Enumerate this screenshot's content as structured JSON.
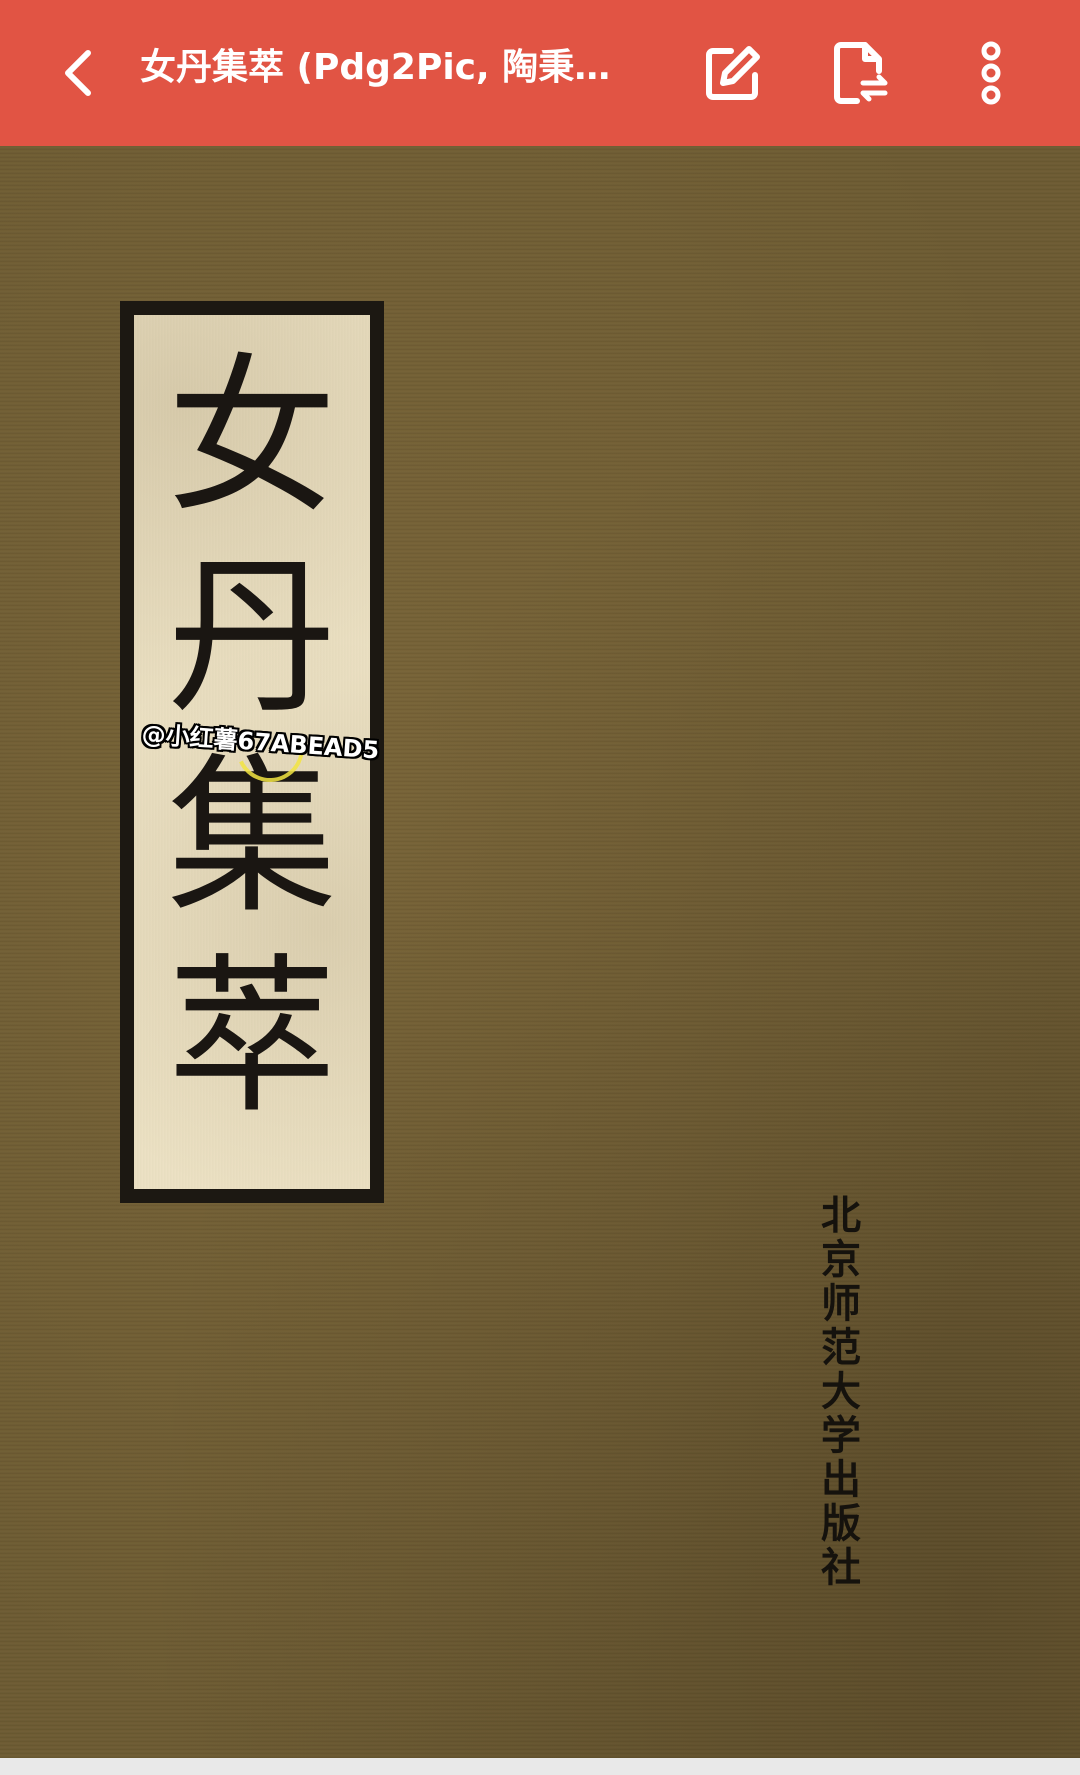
{
  "app_bar": {
    "title": "女丹集萃 (Pdg2Pic, 陶秉福…",
    "background_color": "#e15444",
    "icons": {
      "back": "chevron-left-icon",
      "edit": "edit-icon",
      "convert": "file-convert-icon",
      "more": "more-vertical-icon"
    }
  },
  "page": {
    "title_chars": [
      "女",
      "丹",
      "集",
      "萃"
    ],
    "publisher_chars": [
      "北",
      "京",
      "师",
      "范",
      "大",
      "学",
      "出",
      "版",
      "社"
    ],
    "watermark": "@小红薯67ABEAD5",
    "cover_color": "#6e5c33",
    "label_color": "#ede2c4"
  }
}
